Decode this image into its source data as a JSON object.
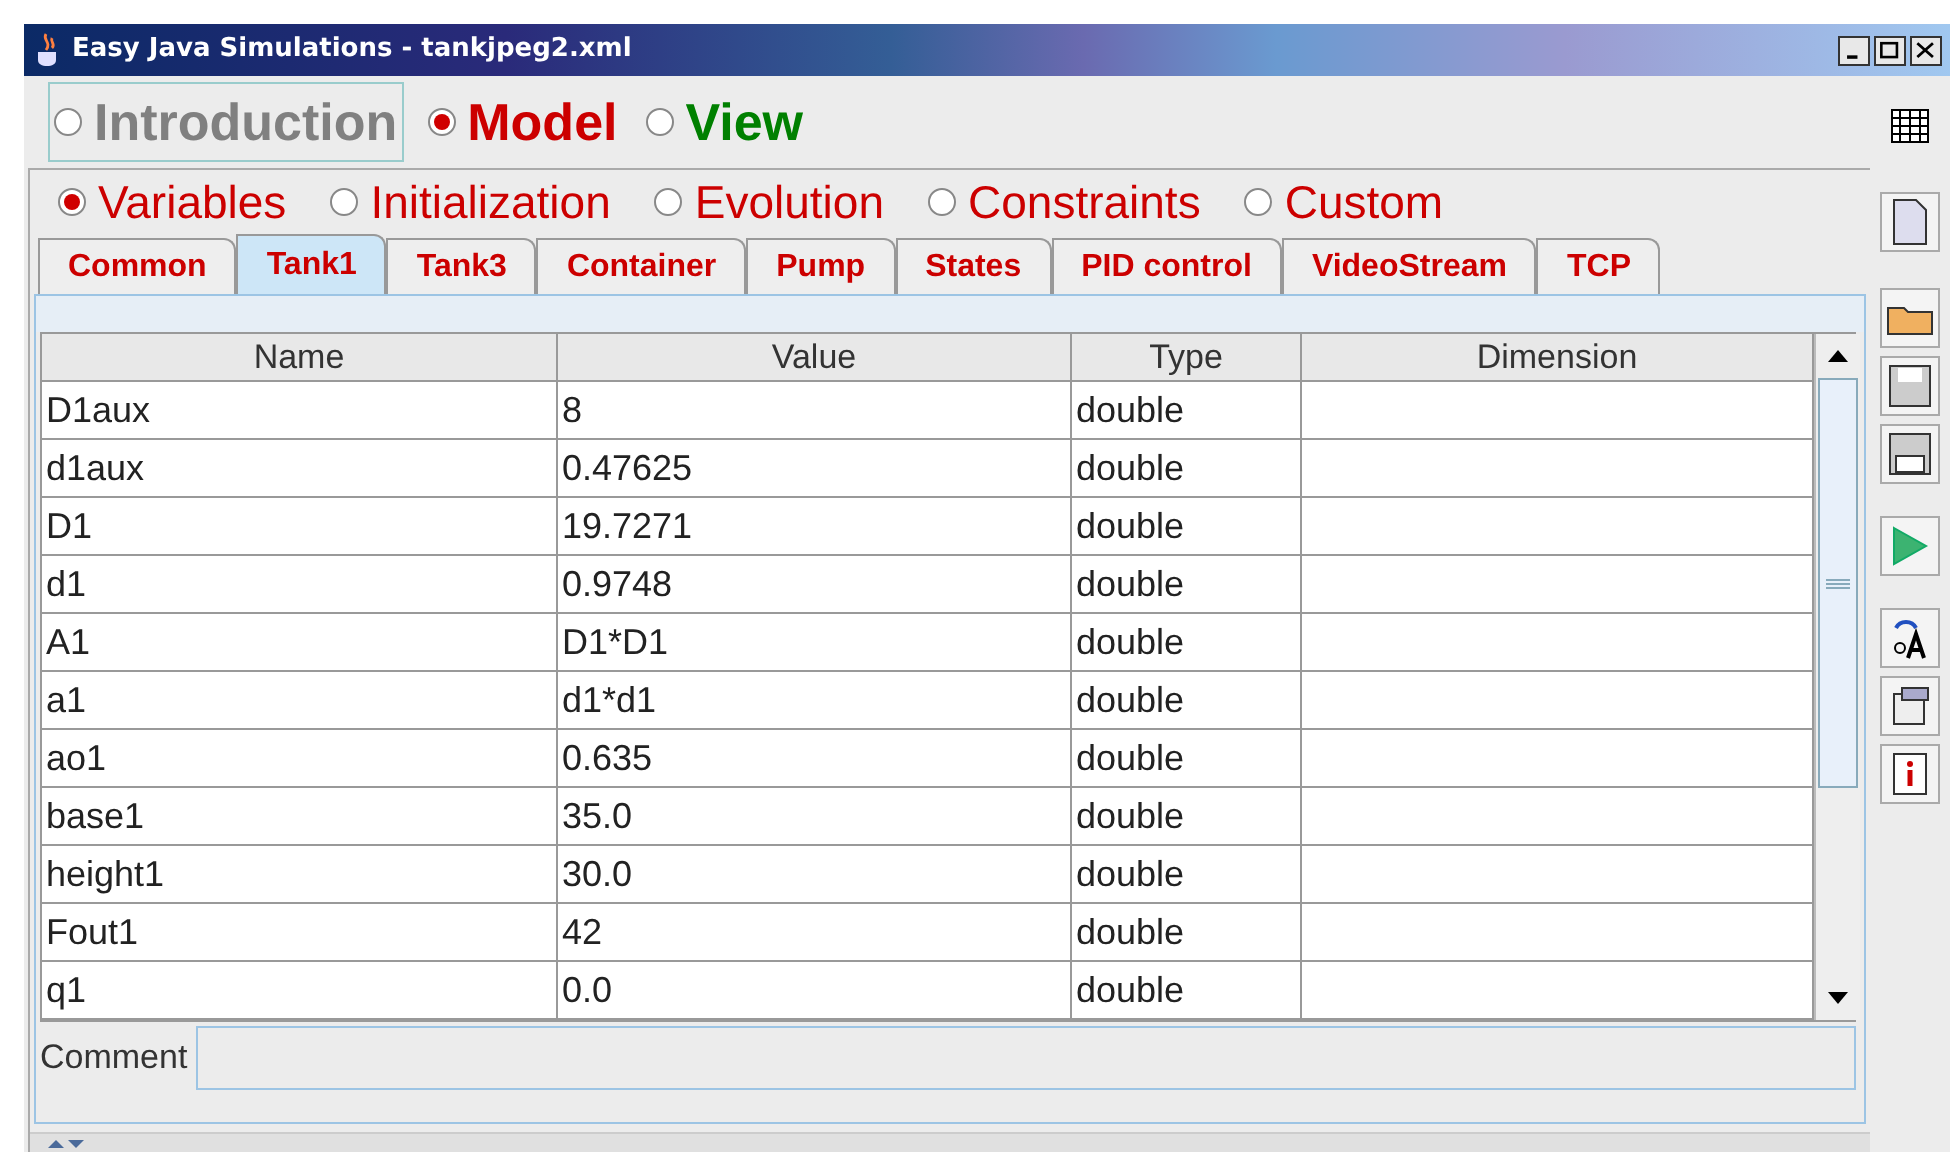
{
  "window": {
    "title": "Easy Java Simulations - tankjpeg2.xml"
  },
  "modes": [
    {
      "label": "Introduction",
      "selected": false,
      "color": "#808080"
    },
    {
      "label": "Model",
      "selected": true,
      "color": "#cc0000"
    },
    {
      "label": "View",
      "selected": false,
      "color": "#008000"
    }
  ],
  "sections": [
    {
      "label": "Variables",
      "selected": true
    },
    {
      "label": "Initialization",
      "selected": false
    },
    {
      "label": "Evolution",
      "selected": false
    },
    {
      "label": "Constraints",
      "selected": false
    },
    {
      "label": "Custom",
      "selected": false
    }
  ],
  "tabs": [
    {
      "label": "Common",
      "selected": false
    },
    {
      "label": "Tank1",
      "selected": true
    },
    {
      "label": "Tank3",
      "selected": false
    },
    {
      "label": "Container",
      "selected": false
    },
    {
      "label": "Pump",
      "selected": false
    },
    {
      "label": "States",
      "selected": false
    },
    {
      "label": "PID control",
      "selected": false
    },
    {
      "label": "VideoStream",
      "selected": false
    },
    {
      "label": "TCP",
      "selected": false
    }
  ],
  "table": {
    "columns": [
      "Name",
      "Value",
      "Type",
      "Dimension"
    ],
    "rows": [
      [
        "D1aux",
        "8",
        "double",
        ""
      ],
      [
        "d1aux",
        "0.47625",
        "double",
        ""
      ],
      [
        "D1",
        "19.7271",
        "double",
        ""
      ],
      [
        "d1",
        "0.9748",
        "double",
        ""
      ],
      [
        "A1",
        "D1*D1",
        "double",
        ""
      ],
      [
        "a1",
        "d1*d1",
        "double",
        ""
      ],
      [
        "ao1",
        "0.635",
        "double",
        ""
      ],
      [
        "base1",
        "35.0",
        "double",
        ""
      ],
      [
        "height1",
        "30.0",
        "double",
        ""
      ],
      [
        "Fout1",
        "42",
        "double",
        ""
      ],
      [
        "q1",
        "0.0",
        "double",
        ""
      ]
    ]
  },
  "comment": {
    "label": "Comment"
  }
}
